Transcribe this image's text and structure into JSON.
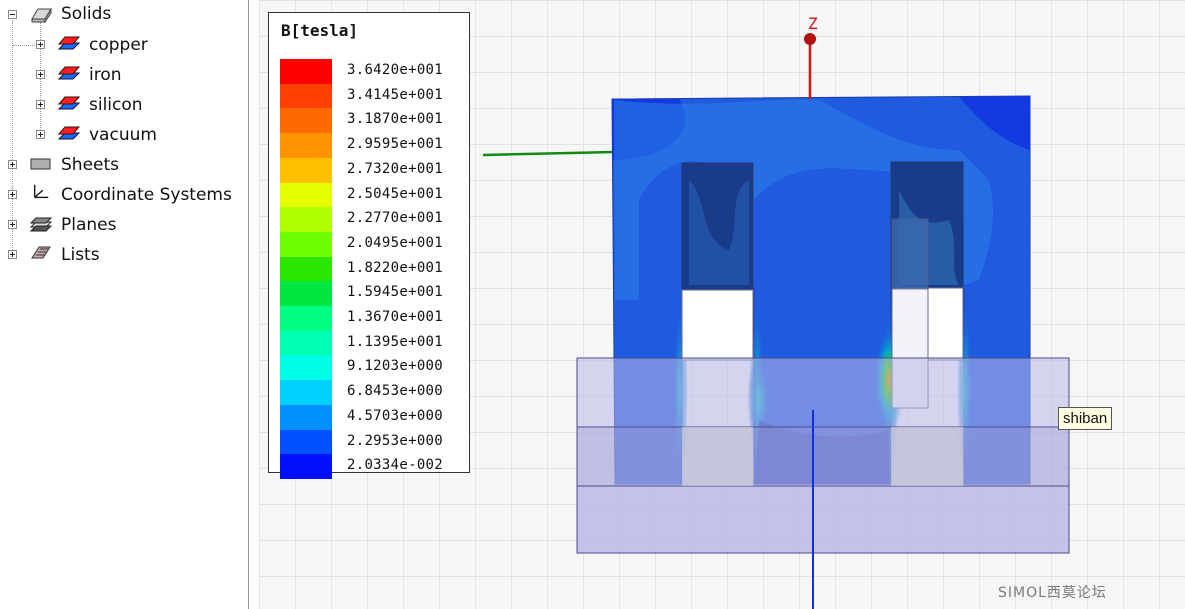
{
  "tree": {
    "items": [
      {
        "label": "Solids",
        "icon": "solid-box-icon",
        "expanded": true,
        "level": 0
      },
      {
        "label": "copper",
        "icon": "material-layers-icon",
        "expanded": false,
        "level": 1
      },
      {
        "label": "iron",
        "icon": "material-layers-icon",
        "expanded": false,
        "level": 1
      },
      {
        "label": "silicon",
        "icon": "material-layers-icon",
        "expanded": false,
        "level": 1
      },
      {
        "label": "vacuum",
        "icon": "material-layers-icon",
        "expanded": false,
        "level": 1
      },
      {
        "label": "Sheets",
        "icon": "sheet-icon",
        "expanded": false,
        "level": 0
      },
      {
        "label": "Coordinate Systems",
        "icon": "axes-icon",
        "expanded": false,
        "level": 0
      },
      {
        "label": "Planes",
        "icon": "plane-icon",
        "expanded": false,
        "level": 0
      },
      {
        "label": "Lists",
        "icon": "list-icon",
        "expanded": false,
        "level": 0
      }
    ]
  },
  "legend": {
    "title": "B[tesla]",
    "entries": [
      {
        "value": "3.6420e+001",
        "color": "#ff0000"
      },
      {
        "value": "3.4145e+001",
        "color": "#ff4000"
      },
      {
        "value": "3.1870e+001",
        "color": "#ff6a00"
      },
      {
        "value": "2.9595e+001",
        "color": "#ff9400"
      },
      {
        "value": "2.7320e+001",
        "color": "#ffc000"
      },
      {
        "value": "2.5045e+001",
        "color": "#e6ff00"
      },
      {
        "value": "2.2770e+001",
        "color": "#b0ff00"
      },
      {
        "value": "2.0495e+001",
        "color": "#6eff00"
      },
      {
        "value": "1.8220e+001",
        "color": "#2be600"
      },
      {
        "value": "1.5945e+001",
        "color": "#00e640"
      },
      {
        "value": "1.3670e+001",
        "color": "#00ff80"
      },
      {
        "value": "1.1395e+001",
        "color": "#00ffb0"
      },
      {
        "value": "9.1203e+000",
        "color": "#00ffe6"
      },
      {
        "value": "6.8453e+000",
        "color": "#00d0ff"
      },
      {
        "value": "4.5703e+000",
        "color": "#0090ff"
      },
      {
        "value": "2.2953e+000",
        "color": "#0050ff"
      },
      {
        "value": "2.0334e-002",
        "color": "#0010ff"
      }
    ]
  },
  "axis_label": "Z",
  "tooltip": "shiban",
  "watermark": "SIMOL西莫论坛"
}
